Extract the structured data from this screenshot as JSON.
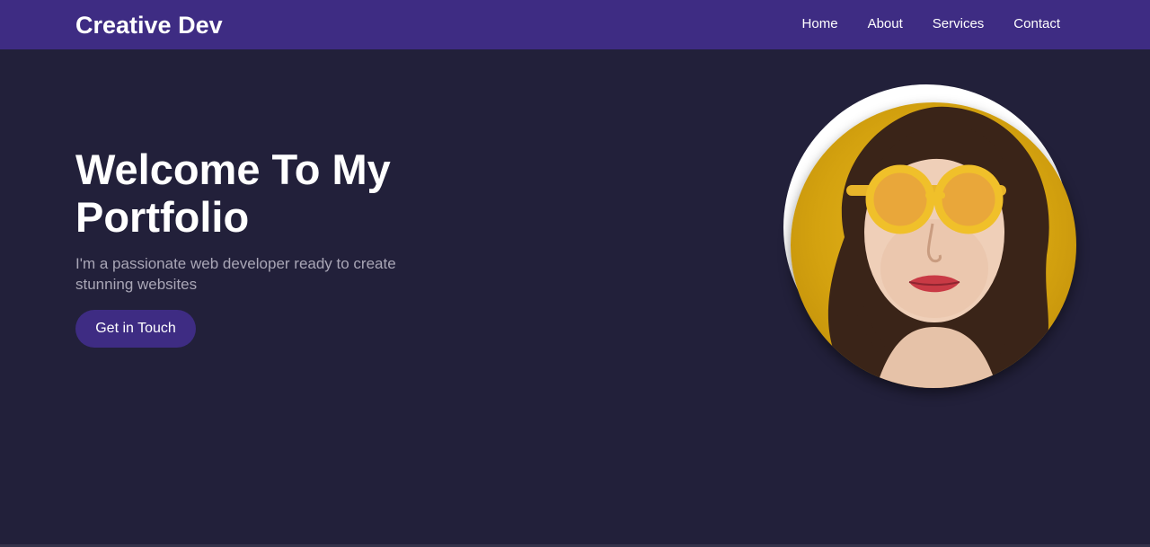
{
  "navbar": {
    "brand": "Creative Dev",
    "links": [
      {
        "label": "Home"
      },
      {
        "label": "About"
      },
      {
        "label": "Services"
      },
      {
        "label": "Contact"
      }
    ]
  },
  "hero": {
    "title": "Welcome To My Portfolio",
    "subtitle": "I'm a passionate web developer ready to create stunning websites",
    "cta_label": "Get in Touch",
    "image_alt": "portrait of a woman wearing yellow round sunglasses"
  },
  "colors": {
    "navbar_bg": "#3e2c83",
    "page_bg": "#22203a",
    "accent": "#3e2c83",
    "text_primary": "#ffffff",
    "text_muted": "#a9a6b6",
    "portrait_bg": "#d4a20f"
  }
}
